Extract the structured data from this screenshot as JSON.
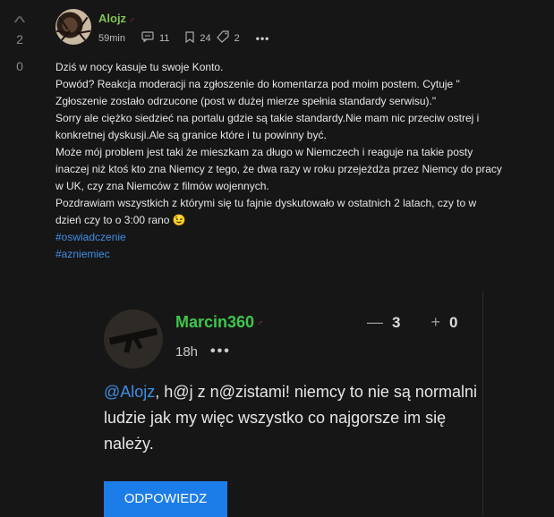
{
  "post": {
    "vote_up_count": "2",
    "vote_down_count": "0",
    "author": "Alojz",
    "time": "59min",
    "comments": "11",
    "bookmarks": "24",
    "shares": "2",
    "paragraphs": [
      "Dziś w nocy kasuje tu swoje Konto.",
      "Powód? Reakcja moderacji na zgłoszenie do komentarza pod moim postem. Cytuje \"",
      "Zgłoszenie zostało odrzucone (post w dużej mierze spełnia standardy serwisu).\"",
      "Sorry ale ciężko siedzieć na portalu gdzie są takie standardy.Nie mam nic przeciw ostrej i konkretnej dyskusji.Ale są granice które i tu powinny być.",
      "Może mój problem jest taki że mieszkam za długo w Niemczech i reaguje na takie posty inaczej niż ktoś kto zna Niemcy z tego, że dwa razy w roku przejeżdża przez Niemcy do pracy w UK, czy zna Niemców z filmów wojennych.",
      "Pozdrawiam wszystkich z którymi się tu fajnie dyskutowało w ostatnich 2 latach, czy to w dzień czy to o 3:00 rano 😉"
    ],
    "tags": [
      "#oswiadczenie",
      "#azniemiec"
    ]
  },
  "reply": {
    "author": "Marcin360",
    "time": "18h",
    "minus_label": "—",
    "minus_count": "3",
    "plus_label": "+",
    "plus_count": "0",
    "mention": "@Alojz",
    "text": ", h@j z n@zistami! niemcy to nie są normalni ludzie jak my więc wszystko co najgorsze im się należy.",
    "reply_button": "ODPOWIEDZ"
  },
  "icons": {
    "vote_up": "chevron-up-icon",
    "moderator": "moderator-badge-icon",
    "comments": "comment-icon",
    "bookmark": "bookmark-icon",
    "tag": "tag-icon",
    "more": "more-dots-icon"
  },
  "colors": {
    "background": "#161616",
    "username_post": "#7fc257",
    "username_reply": "#3cc84a",
    "link": "#3d8fe6",
    "button": "#1c7de8"
  }
}
